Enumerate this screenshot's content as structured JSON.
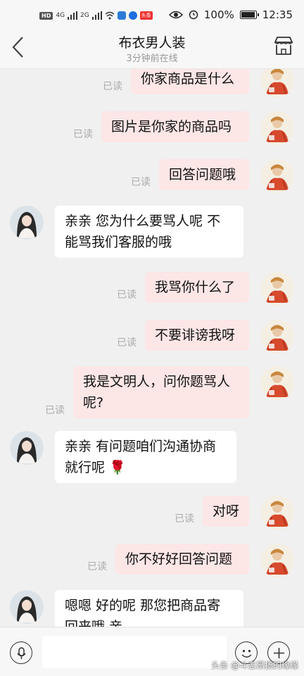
{
  "status_bar": {
    "hd": "HD",
    "signal_1": "4G",
    "signal_2": "2G",
    "badge_label": "头条",
    "battery": "100%",
    "battery_level": 1.0,
    "time": "12:35"
  },
  "header": {
    "title": "布衣男人装",
    "subtitle": "3分钟前在线",
    "icons": [
      "back-arrow-icon",
      "shop-icon"
    ]
  },
  "read_label": "已读",
  "messages": [
    {
      "side": "out",
      "lines": [
        "你家商品是什么"
      ],
      "read": true
    },
    {
      "side": "out",
      "lines": [
        "图片是你家的商品吗"
      ],
      "read": true
    },
    {
      "side": "out",
      "lines": [
        "回答问题哦"
      ],
      "read": true
    },
    {
      "side": "in",
      "lines": [
        "亲亲 您为什么要骂人呢  不",
        "能骂我们客服的哦"
      ]
    },
    {
      "side": "out",
      "lines": [
        "我骂你什么了"
      ],
      "read": true
    },
    {
      "side": "out",
      "lines": [
        "不要诽谤我呀"
      ],
      "read": true
    },
    {
      "side": "out",
      "lines": [
        "我是文明人，问你题骂人",
        "呢?"
      ],
      "read": true
    },
    {
      "side": "in",
      "lines": [
        "亲亲 有问题咱们沟通协商",
        "就行呢 🌹"
      ]
    },
    {
      "side": "out",
      "lines": [
        "对呀"
      ],
      "read": true
    },
    {
      "side": "out",
      "lines": [
        "你不好好回答问题"
      ],
      "read": true
    },
    {
      "side": "in",
      "lines": [
        "嗯嗯  好的呢 那您把商品寄",
        "回来哦 亲"
      ]
    }
  ],
  "input_bar": {
    "icons": [
      "voice-icon",
      "emoji-icon",
      "plus-icon"
    ]
  },
  "watermark": "头条 @斗志昂扬的缘缘",
  "colors": {
    "outgoing_bubble": "#fde6e6",
    "incoming_bubble": "#ffffff",
    "background": "#f0f0f0"
  }
}
